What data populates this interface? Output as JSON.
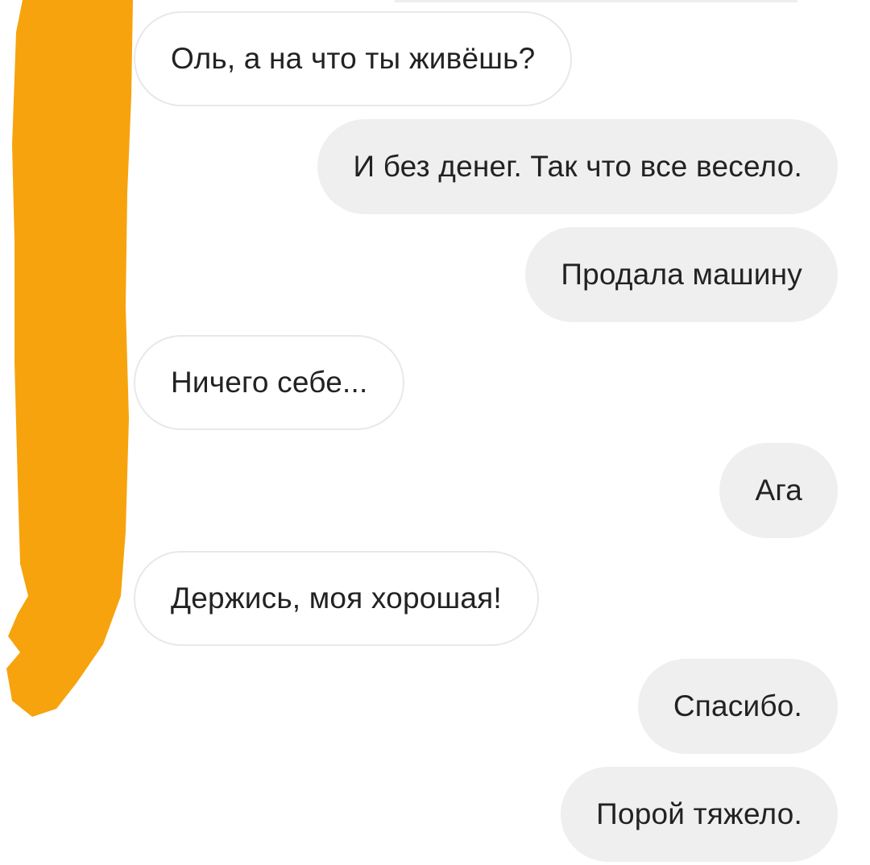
{
  "colors": {
    "incoming_bubble": "#ffffff",
    "outgoing_bubble": "#efefef",
    "redaction": "#f7a30e",
    "text": "#222222"
  },
  "messages": [
    {
      "direction": "incoming",
      "text": "Оль, а на что ты живёшь?"
    },
    {
      "direction": "outgoing",
      "text": "И без денег. Так что все весело."
    },
    {
      "direction": "outgoing",
      "text": "Продала машину"
    },
    {
      "direction": "incoming",
      "text": "Ничего себе..."
    },
    {
      "direction": "outgoing",
      "text": "Ага"
    },
    {
      "direction": "incoming",
      "text": "Держись, моя хорошая!"
    },
    {
      "direction": "outgoing",
      "text": "Спасибо."
    },
    {
      "direction": "outgoing",
      "text": "Порой тяжело."
    }
  ]
}
